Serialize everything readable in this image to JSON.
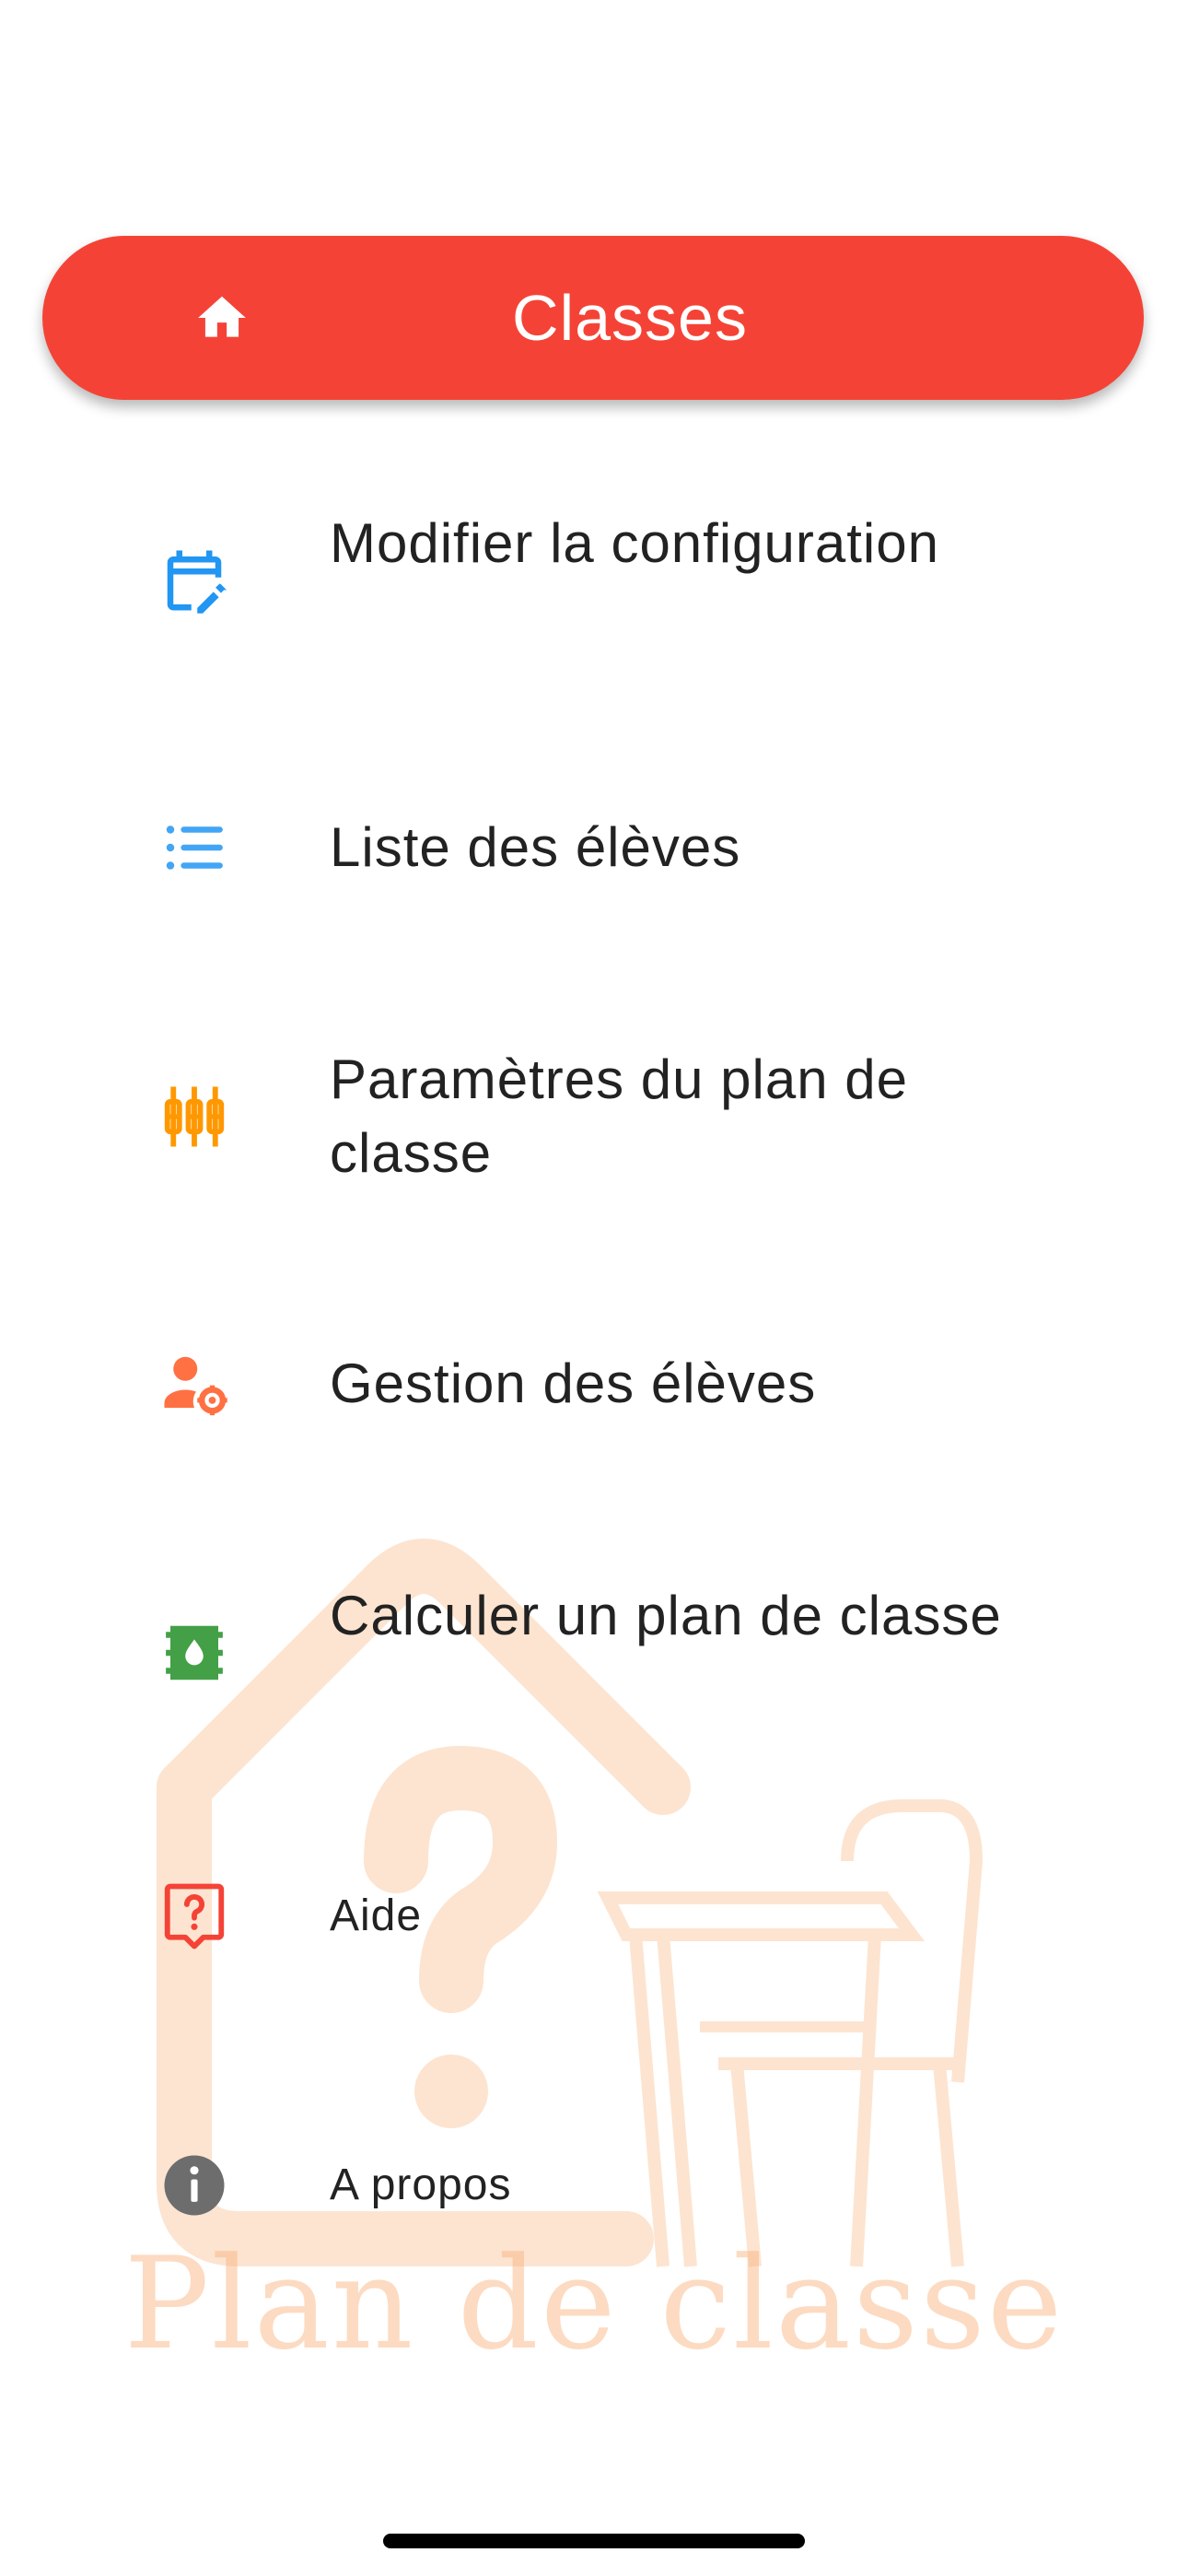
{
  "header": {
    "title": "Classes",
    "icon": "home-icon",
    "color": "#f44336"
  },
  "menu": {
    "items": [
      {
        "label": "Modifier la configuration",
        "icon": "calendar-edit-icon",
        "color": "#2196f3"
      },
      {
        "label": "Liste des élèves",
        "icon": "list-icon",
        "color": "#42a5f5"
      },
      {
        "label": "Paramètres du plan de classe",
        "icon": "tune-icon",
        "color": "#ff9800"
      },
      {
        "label": "Gestion des élèves",
        "icon": "person-settings-icon",
        "color": "#ff7043"
      },
      {
        "label": "Calculer un plan de classe",
        "icon": "calculate-plan-icon",
        "color": "#43a047"
      },
      {
        "label": "Aide",
        "icon": "help-icon",
        "color": "#f44336"
      },
      {
        "label": "A propos",
        "icon": "info-icon",
        "color": "#6d6d6d"
      }
    ]
  },
  "watermark": {
    "text": "Plan de classe",
    "icon": "house-desk-logo"
  }
}
